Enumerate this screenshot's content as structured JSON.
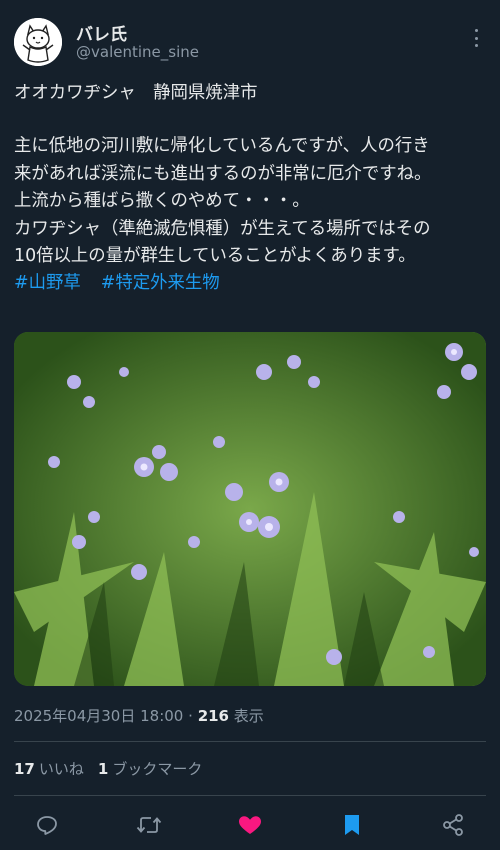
{
  "post": {
    "author_name": "バレ氏",
    "author_handle": "@valentine_sine",
    "lines": [
      "オオカワヂシャ　静岡県焼津市",
      "主に低地の河川敷に帰化しているんですが、人の行き",
      "来があれば渓流にも進出するのが非常に厄介ですね。",
      "上流から種ばら撒くのやめて・・・。",
      "カワヂシャ（準絶滅危惧種）が生えてる場所ではその",
      "10倍以上の量が群生していることがよくあります。"
    ],
    "hashtags": [
      "#山野草",
      "#特定外来生物"
    ],
    "timestamp": "2025年04月30日 18:00",
    "separator": "·",
    "views_count": "216",
    "views_label": "表示",
    "likes_count": "17",
    "likes_label": "いいね",
    "bookmarks_count": "1",
    "bookmarks_label": "ブックマーク"
  },
  "colors": {
    "background": "#15202b",
    "text": "#e7e9ea",
    "muted": "#8b98a5",
    "link": "#1d9bf0",
    "like": "#f91880",
    "bookmark": "#1d9bf0"
  },
  "icons": [
    "more-vert-icon",
    "reply-icon",
    "retweet-icon",
    "like-icon",
    "bookmark-icon",
    "share-icon"
  ]
}
